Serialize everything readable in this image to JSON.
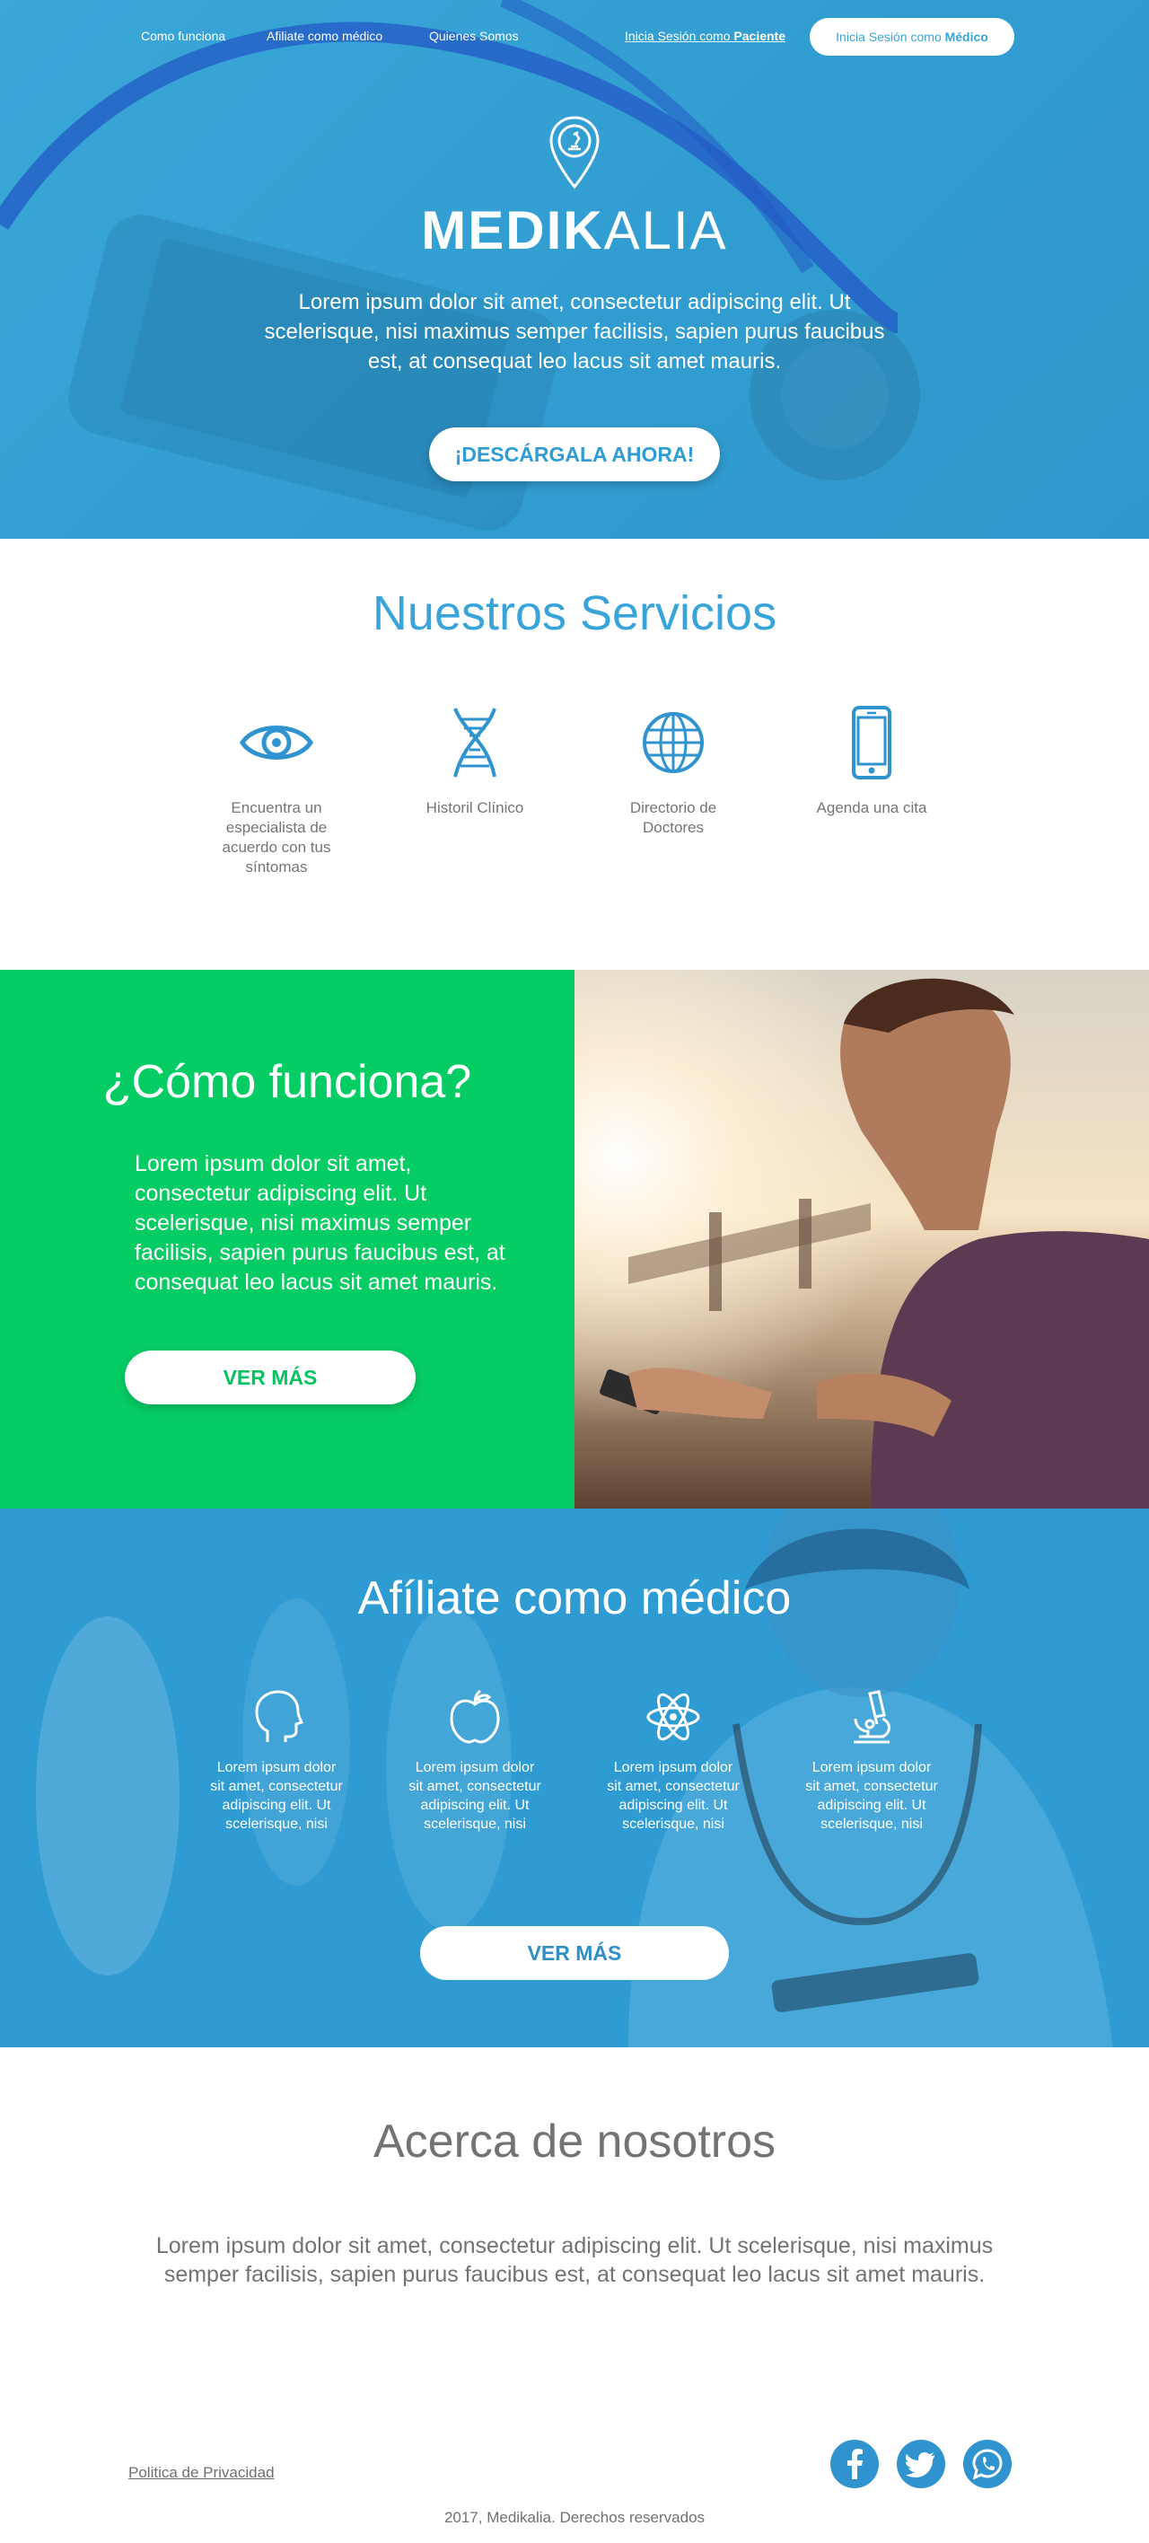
{
  "nav": {
    "links": [
      "Como funciona",
      "Afiliate como médico",
      "Quienes Somos"
    ],
    "patient_prefix": "Inicia Sesión como ",
    "patient_strong": "Paciente",
    "medico_prefix": "Inicia Sesión como ",
    "medico_strong": "Médico"
  },
  "hero": {
    "brand_bold": "MEDIK",
    "brand_light": "ALIA",
    "text": "Lorem ipsum dolor sit amet, consectetur adipiscing elit. Ut scelerisque, nisi maximus semper facilisis, sapien purus faucibus est, at consequat leo lacus sit amet mauris.",
    "cta": "¡DESCÁRGALA AHORA!"
  },
  "services": {
    "title": "Nuestros Servicios",
    "items": [
      {
        "icon": "eye-icon",
        "label": "Encuentra un especialista de acuerdo con tus síntomas"
      },
      {
        "icon": "dna-icon",
        "label": "Historil Clínico"
      },
      {
        "icon": "globe-icon",
        "label": "Directorio de Doctores"
      },
      {
        "icon": "smartphone-icon",
        "label": "Agenda una cita"
      }
    ]
  },
  "como": {
    "title": "¿Cómo funciona?",
    "text": "Lorem ipsum dolor sit amet, consectetur adipiscing elit. Ut scelerisque, nisi maximus semper facilisis, sapien purus faucibus est, at consequat leo lacus sit amet mauris.",
    "cta": "VER MÁS"
  },
  "afiliate": {
    "title": "Afíliate como médico",
    "features": [
      {
        "icon": "head-icon",
        "text": "Lorem ipsum dolor sit amet, consectetur adipiscing elit. Ut scelerisque, nisi"
      },
      {
        "icon": "apple-icon",
        "text": "Lorem ipsum dolor sit amet, consectetur adipiscing elit. Ut scelerisque, nisi"
      },
      {
        "icon": "atom-icon",
        "text": "Lorem ipsum dolor sit amet, consectetur adipiscing elit. Ut scelerisque, nisi"
      },
      {
        "icon": "microscope-icon",
        "text": "Lorem ipsum dolor sit amet, consectetur adipiscing elit. Ut scelerisque, nisi"
      }
    ],
    "cta": "VER MÁS"
  },
  "acerca": {
    "title": "Acerca de nosotros",
    "text": "Lorem ipsum dolor sit amet, consectetur adipiscing elit. Ut scelerisque, nisi maximus semper facilisis, sapien purus faucibus est, at consequat leo lacus sit amet mauris."
  },
  "footer": {
    "privacy": "Politica de Privacidad",
    "social": [
      "facebook-icon",
      "twitter-icon",
      "whatsapp-icon"
    ],
    "copyright": "2017, Medikalia. Derechos reservados"
  },
  "colors": {
    "hero_blue": "#2f9bd0",
    "services_blue": "#39a4da",
    "green": "#06cc64",
    "social_blue": "#2f93cf",
    "text_gray": "#737373"
  }
}
